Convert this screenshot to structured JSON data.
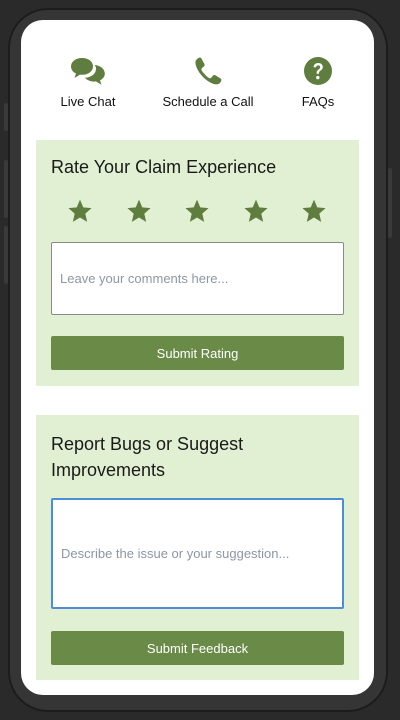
{
  "nav": {
    "live_chat": "Live Chat",
    "schedule_call": "Schedule a Call",
    "faqs": "FAQs"
  },
  "rating": {
    "title": "Rate Your Claim Experience",
    "stars_total": 5,
    "comment_placeholder": "Leave your comments here...",
    "submit_label": "Submit Rating"
  },
  "feedback": {
    "title_line1": "Report Bugs or Suggest",
    "title_line2": "Improvements",
    "placeholder": "Describe the issue or your suggestion...",
    "submit_label": "Submit Feedback"
  },
  "colors": {
    "accent": "#5f7d3f",
    "card_bg": "#e1f0d2",
    "button": "#6a8a48"
  }
}
